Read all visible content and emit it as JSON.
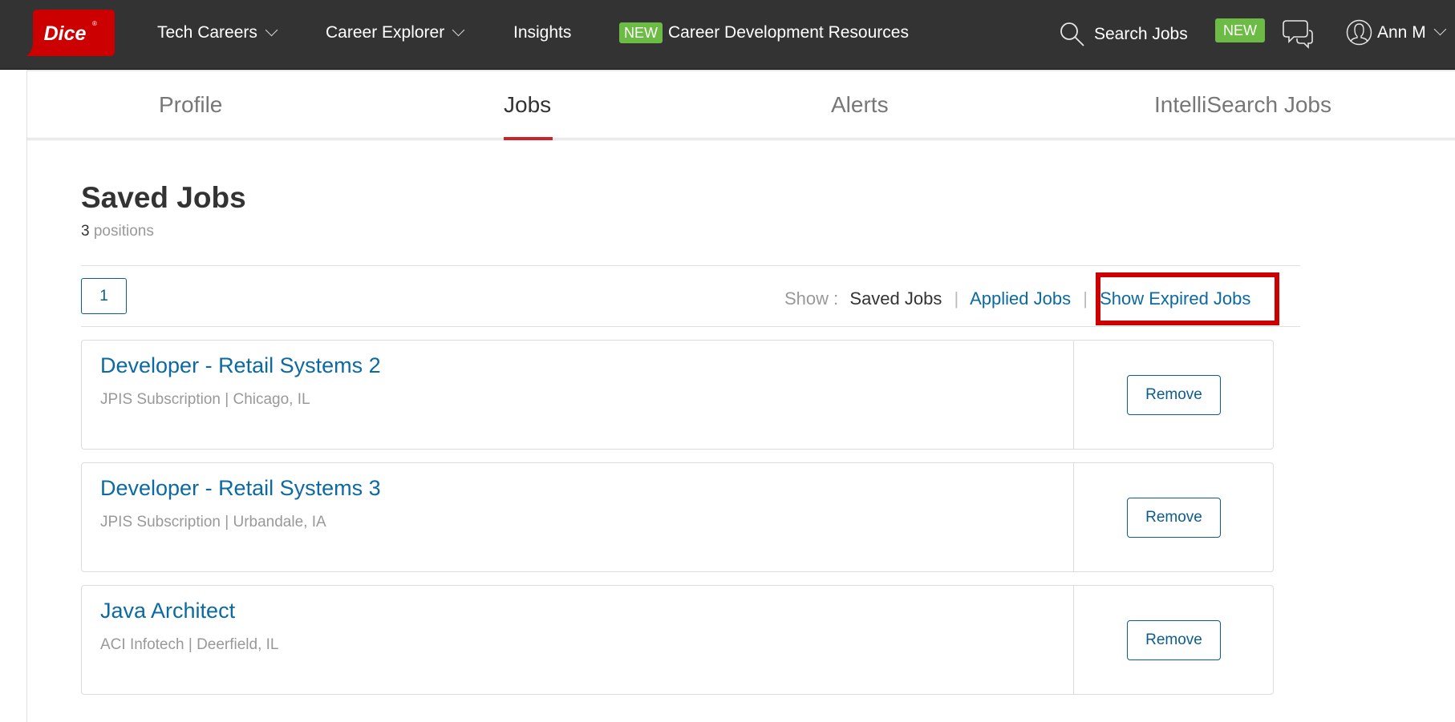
{
  "header": {
    "logo_text": "Dice",
    "nav": [
      {
        "label": "Tech Careers",
        "has_dropdown": true
      },
      {
        "label": "Career Explorer",
        "has_dropdown": true
      },
      {
        "label": "Insights",
        "has_dropdown": false
      },
      {
        "label": "Career Development Resources",
        "badge": "NEW",
        "has_dropdown": false
      }
    ],
    "search_label": "Search Jobs",
    "new_badge": "NEW",
    "user_name": "Ann M",
    "icons": {
      "search": "search-icon",
      "chat": "chat-bubbles-icon",
      "user": "user-avatar-icon",
      "dropdown": "chevron-down-icon"
    },
    "colors": {
      "background": "#333333",
      "logo_red": "#cc0000",
      "badge_green": "#6cbb45"
    }
  },
  "tabs": [
    {
      "label": "Profile",
      "active": false
    },
    {
      "label": "Jobs",
      "active": true
    },
    {
      "label": "Alerts",
      "active": false
    },
    {
      "label": "IntelliSearch Jobs",
      "active": false
    }
  ],
  "main": {
    "title": "Saved Jobs",
    "count_number": "3",
    "count_label": "positions",
    "pagination": {
      "current_page": "1"
    },
    "show_filter": {
      "label": "Show :",
      "current": "Saved Jobs",
      "links": [
        "Applied Jobs",
        "Show Expired Jobs"
      ],
      "separator": "|"
    },
    "remove_label": "Remove",
    "jobs": [
      {
        "title": "Developer - Retail Systems 2",
        "company": "JPIS Subscription",
        "location": "Chicago, IL"
      },
      {
        "title": "Developer - Retail Systems 3",
        "company": "JPIS Subscription",
        "location": "Urbandale, IA"
      },
      {
        "title": "Java Architect",
        "company": "ACI Infotech",
        "location": "Deerfield, IL"
      }
    ],
    "colors": {
      "link": "#0b6aa2",
      "active_tab_underline": "#cc2229",
      "highlight_box": "#cc0000"
    }
  }
}
